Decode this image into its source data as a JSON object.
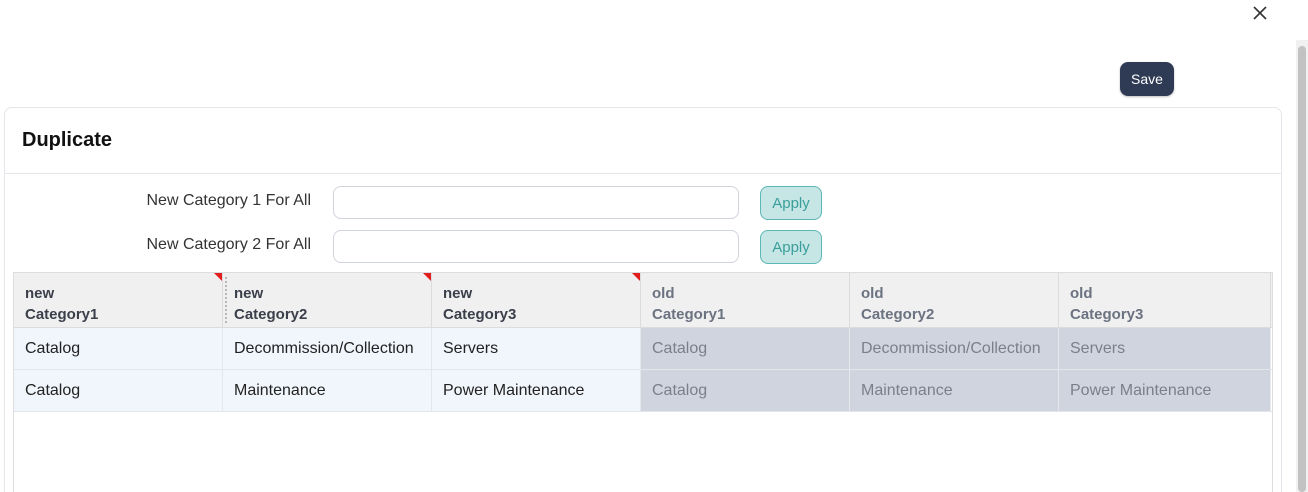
{
  "dialog": {
    "close_icon": "close-icon",
    "save_label": "Save"
  },
  "panel": {
    "title": "Duplicate",
    "form": [
      {
        "label": "New Category 1 For All",
        "value": "",
        "apply_label": "Apply"
      },
      {
        "label": "New Category 2 For All",
        "value": "",
        "apply_label": "Apply"
      }
    ]
  },
  "grid": {
    "columns": [
      {
        "line1": "new",
        "line2": "Category1",
        "editable": true
      },
      {
        "line1": "new",
        "line2": "Category2",
        "editable": true
      },
      {
        "line1": "new",
        "line2": "Category3",
        "editable": true
      },
      {
        "line1": "old",
        "line2": "Category1",
        "editable": false
      },
      {
        "line1": "old",
        "line2": "Category2",
        "editable": false
      },
      {
        "line1": "old",
        "line2": "Category3",
        "editable": false
      }
    ],
    "rows": [
      [
        "Catalog",
        "Decommission/Collection",
        "Servers",
        "Catalog",
        "Decommission/Collection",
        "Servers"
      ],
      [
        "Catalog",
        "Maintenance",
        "Power Maintenance",
        "Catalog",
        "Maintenance",
        "Power Maintenance"
      ]
    ]
  },
  "colors": {
    "save_bg": "#2f3b55",
    "apply_bg": "#c6e5e5",
    "apply_border": "#5bb8b5",
    "editable_flag": "#e11d1d",
    "old_cell_bg": "#d0d4de",
    "new_cell_bg": "#f1f6fc"
  }
}
